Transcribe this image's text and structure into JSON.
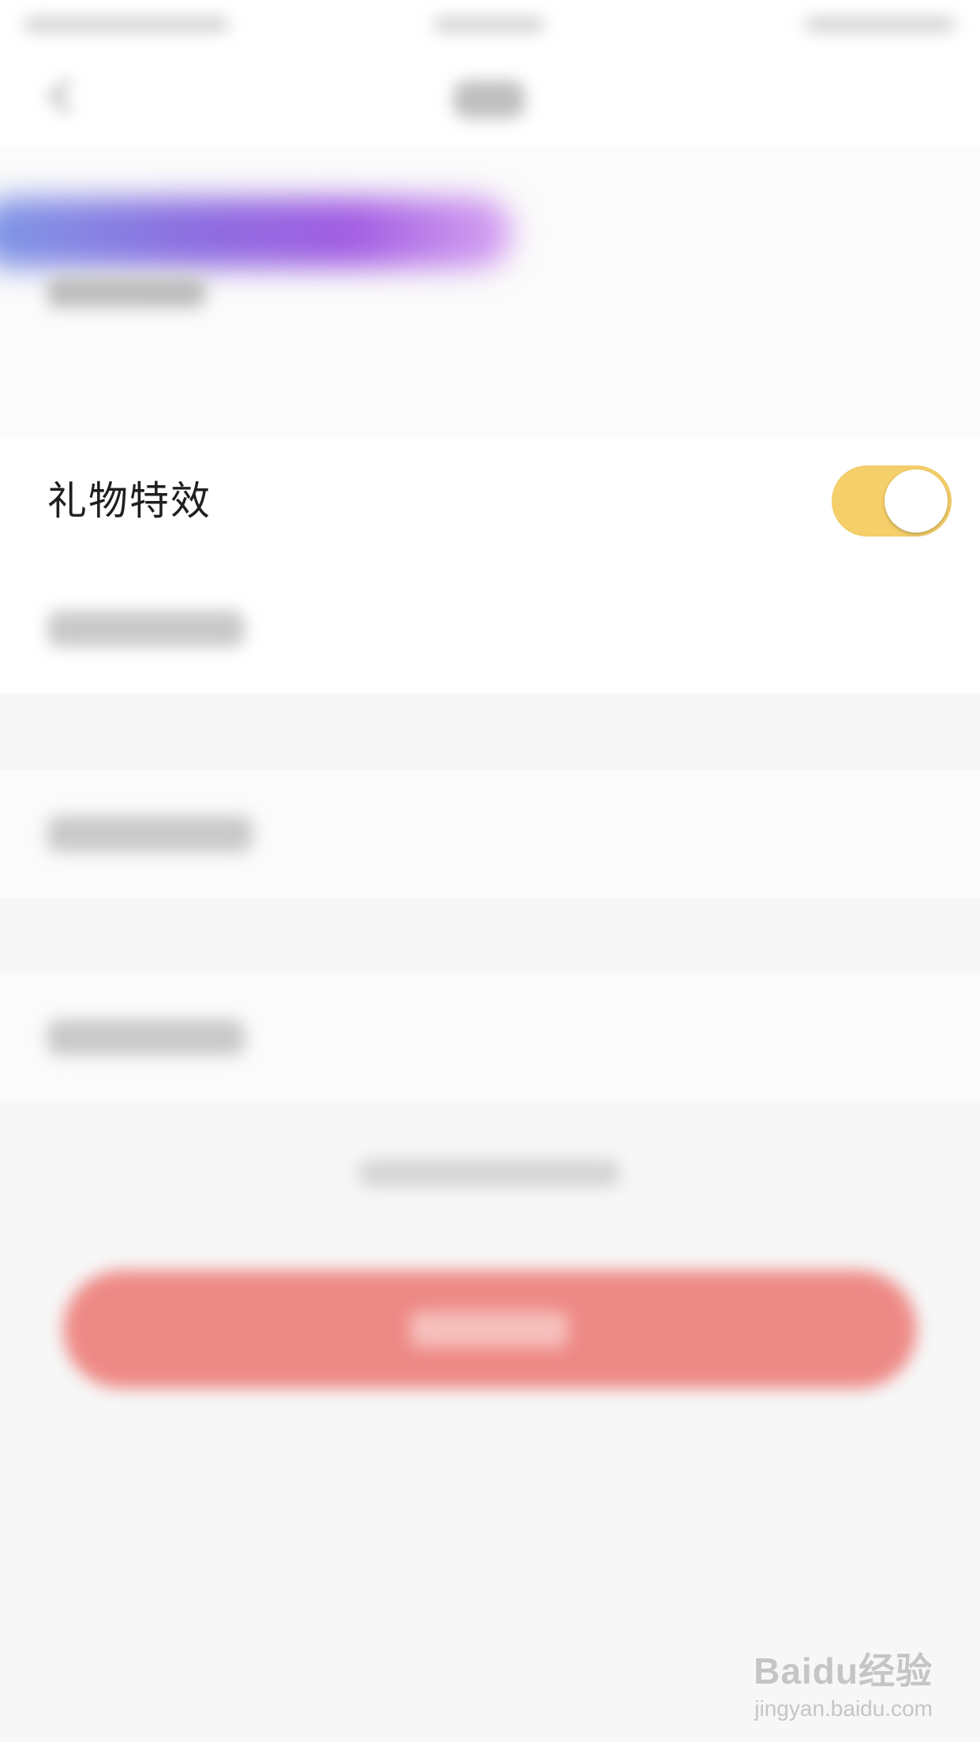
{
  "settings": {
    "rows": [
      {
        "label": "礼物特效",
        "toggle_on": true
      }
    ]
  },
  "colors": {
    "toggle_on": "#f5cf69",
    "primary_button": "#ee8a86",
    "banner_gradient": [
      "#7f9ae6",
      "#8c6ee0",
      "#a25de2",
      "#d8a6f2"
    ]
  },
  "icons": {
    "back": "chevron-left-icon"
  },
  "watermark": {
    "brand": "Baidu经验",
    "url": "jingyan.baidu.com"
  }
}
